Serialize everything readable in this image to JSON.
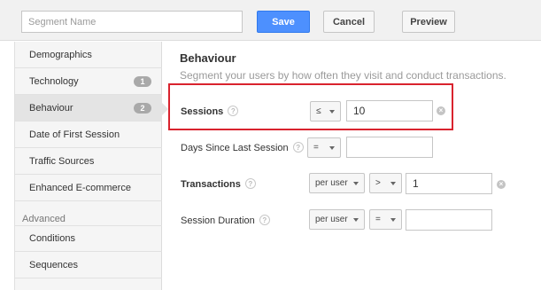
{
  "header": {
    "segment_name_placeholder": "Segment Name",
    "save_label": "Save",
    "cancel_label": "Cancel",
    "preview_label": "Preview"
  },
  "sidebar": {
    "items": [
      {
        "label": "Demographics"
      },
      {
        "label": "Technology",
        "badge": "1"
      },
      {
        "label": "Behaviour",
        "badge": "2",
        "active": true
      },
      {
        "label": "Date of First Session"
      },
      {
        "label": "Traffic Sources"
      },
      {
        "label": "Enhanced E-commerce"
      }
    ],
    "advanced_heading": "Advanced",
    "advanced_items": [
      {
        "label": "Conditions"
      },
      {
        "label": "Sequences"
      }
    ]
  },
  "main": {
    "title": "Behaviour",
    "subtitle": "Segment your users by how often they visit and conduct transactions.",
    "help_glyph": "?",
    "remove_glyph": "×",
    "rows": {
      "sessions": {
        "label": "Sessions",
        "operator": "≤",
        "value": "10",
        "highlighted": true
      },
      "days_since_last_session": {
        "label": "Days Since Last Session",
        "operator": "=",
        "value": ""
      },
      "transactions": {
        "label": "Transactions",
        "scope": "per user",
        "operator": ">",
        "value": "1"
      },
      "session_duration": {
        "label": "Session Duration",
        "scope": "per user",
        "operator": "=",
        "value": ""
      }
    }
  },
  "colors": {
    "accent": "#4d90fe",
    "highlight": "#d9232e"
  }
}
